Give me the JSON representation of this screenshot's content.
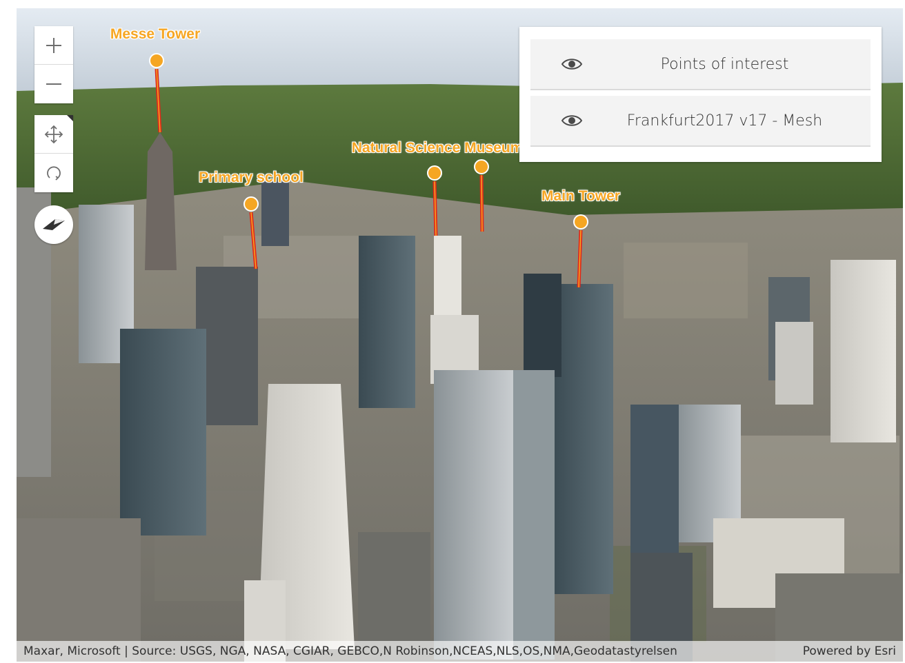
{
  "map": {
    "zoom_in_label": "+",
    "zoom_out_label": "—",
    "poi_labels": [
      {
        "name": "Messe Tower"
      },
      {
        "name": "Primary school"
      },
      {
        "name": "Natural Science Museum"
      },
      {
        "name": "Main Tower"
      }
    ],
    "colors": {
      "poi_label": "#f6a623",
      "poi_pin": "#f5a623",
      "poi_stem": "#e02a1a"
    }
  },
  "layer_list": {
    "items": [
      {
        "title": "Points of interest",
        "icon": "eye-icon"
      },
      {
        "title": "Frankfurt2017 v17 - Mesh",
        "icon": "eye-icon"
      }
    ]
  },
  "attribution": {
    "source": "Maxar, Microsoft | Source: USGS, NGA, NASA, CGIAR, GEBCO,N Robinson,NCEAS,NLS,OS,NMA,Geodatastyrelsen",
    "powered_by": "Powered by Esri"
  }
}
